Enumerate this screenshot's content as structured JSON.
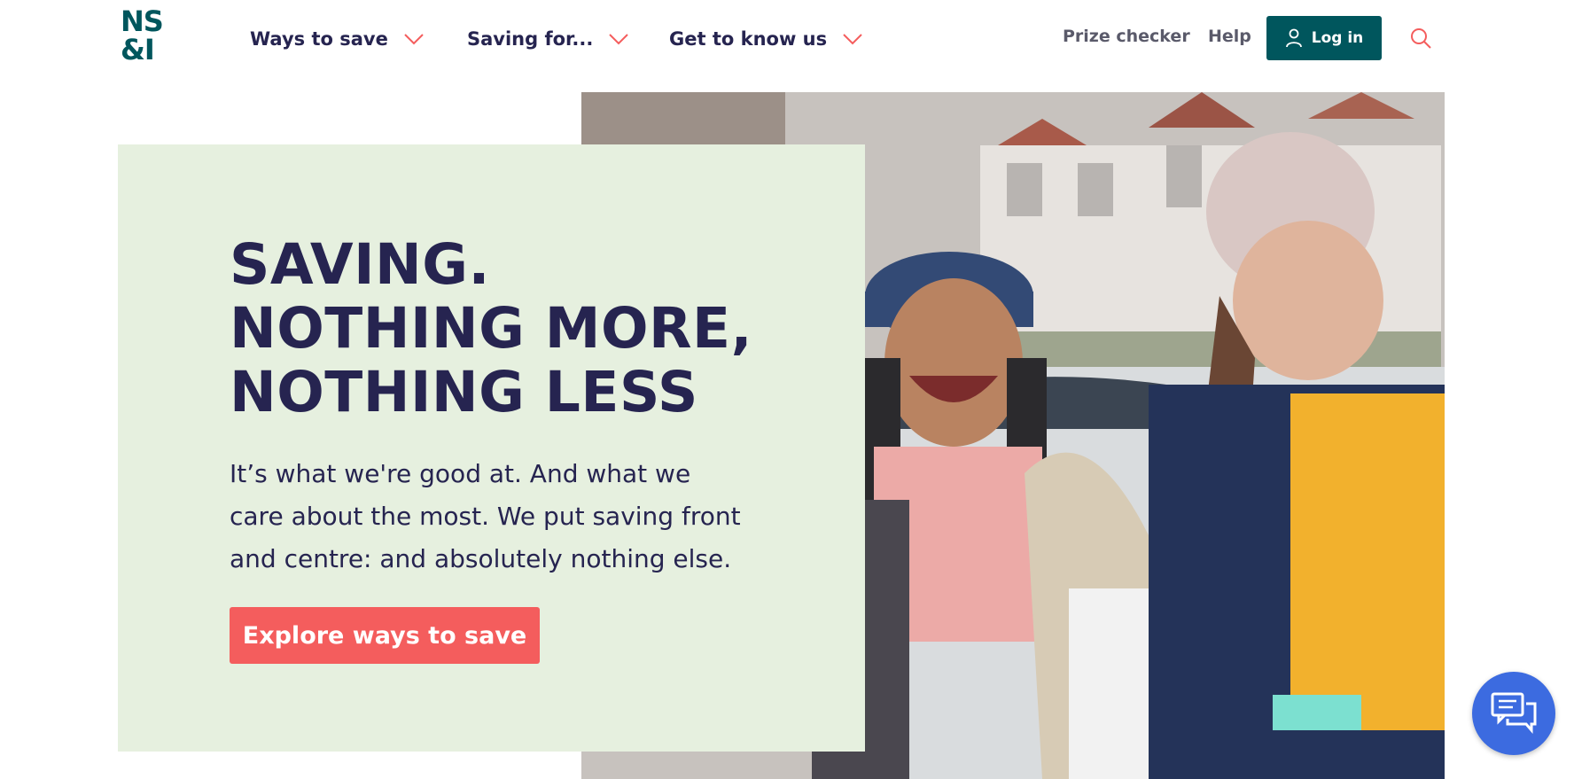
{
  "logo": {
    "line1": "NS",
    "line2": "&I",
    "color": "#00565d"
  },
  "nav": {
    "items": [
      {
        "label": "Ways to save"
      },
      {
        "label": "Saving for..."
      },
      {
        "label": "Get to know us"
      }
    ],
    "chevron_color": "#f45d5d"
  },
  "utility": {
    "prize_checker": "Prize checker",
    "help": "Help",
    "login": "Log in",
    "search_icon": "search-icon"
  },
  "hero": {
    "title_lines": [
      "SAVING.",
      "NOTHING MORE,",
      "NOTHING LESS"
    ],
    "body": "It’s what we're good at. And what we care about the most. We put saving front and centre: and absolutely nothing else.",
    "cta": "Explore ways to save",
    "panel_color": "#e6f0df",
    "cta_color": "#f45d5d"
  },
  "chat": {
    "icon": "chat-icon",
    "color": "#3c6be0"
  }
}
